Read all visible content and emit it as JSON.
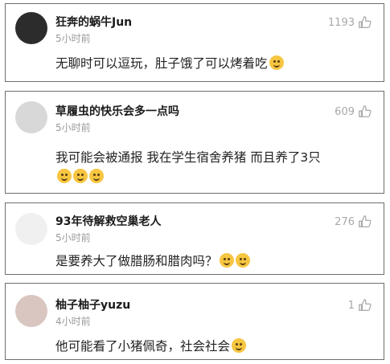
{
  "comments": [
    {
      "username": "狂奔的蜗牛Jun",
      "time": "5小时前",
      "likes": "1193",
      "text": "无聊时可以逗玩，肚子饿了可以烤着吃",
      "emoji_count": 1
    },
    {
      "username": "草履虫的快乐会多一点吗",
      "time": "5小时前",
      "likes": "609",
      "text": "我可能会被通报 我在学生宿舍养猪 而且养了3只",
      "emoji_count": 3
    },
    {
      "username": "93年待解救空巢老人",
      "time": "5小时前",
      "likes": "276",
      "text": "是要养大了做腊肠和腊肉吗？",
      "emoji_count": 2
    },
    {
      "username": "柚子柚子yuzu",
      "time": "4小时前",
      "likes": "1",
      "text": "他可能看了小猪佩奇，社会社会",
      "emoji_count": 1
    }
  ],
  "icons": {
    "like": "thumbs-up-icon",
    "emoji": "laughing-face-icon"
  },
  "colors": {
    "text": "#222222",
    "meta": "#9a9a9a",
    "border": "#6e6e6e"
  }
}
